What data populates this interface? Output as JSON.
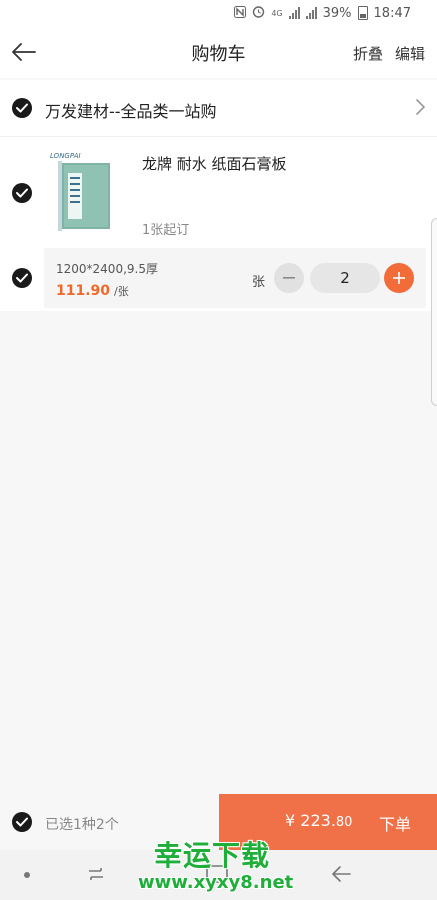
{
  "status_bar": {
    "battery": "39%",
    "time": "18:47",
    "network": "4G"
  },
  "header": {
    "title": "购物车",
    "fold_label": "折叠",
    "edit_label": "编辑"
  },
  "shop": {
    "name": "万发建材--全品类一站购",
    "checked": true
  },
  "product": {
    "name": "龙牌 耐水 纸面石膏板",
    "min_order": "1张起订",
    "thumb_brand": "LONGPAI",
    "checked": true
  },
  "spec": {
    "text": "1200*2400,9.5厚",
    "price": "111.90",
    "price_unit": "/张",
    "unit": "张",
    "quantity": "2",
    "checked": true
  },
  "bottom": {
    "selected": "已选1种2个",
    "currency": "¥",
    "total_int": "223.",
    "total_dec": "80",
    "order_label": "下单"
  },
  "watermark": {
    "cn": "幸运下载",
    "url": "www.xyxy8.net"
  },
  "colors": {
    "accent": "#f07048",
    "price": "#ef6a2a",
    "check": "#1a1a1a"
  },
  "icons": {
    "back": "arrow-left-icon",
    "chevron": "chevron-right-icon",
    "check": "check-circle-icon",
    "minus": "minus-icon",
    "plus": "plus-icon"
  }
}
